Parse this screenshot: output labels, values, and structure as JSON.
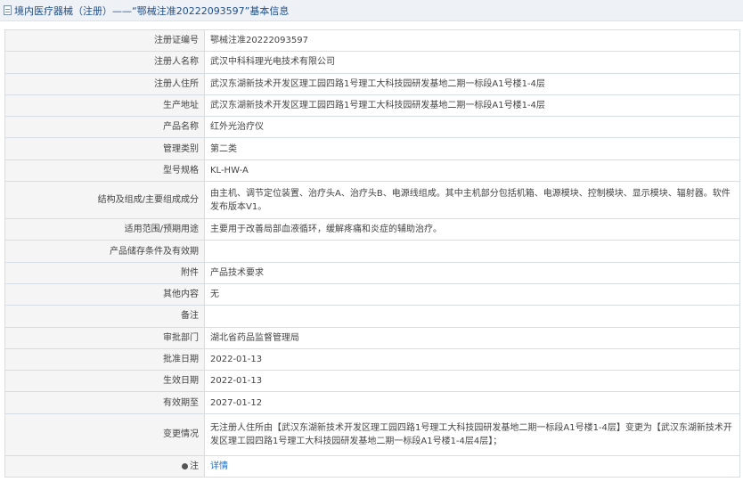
{
  "header": {
    "title": "境内医疗器械（注册）——“鄂械注准20222093597”基本信息"
  },
  "rows": [
    {
      "label": "注册证编号",
      "value": "鄂械注准20222093597"
    },
    {
      "label": "注册人名称",
      "value": "武汉中科科理光电技术有限公司"
    },
    {
      "label": "注册人住所",
      "value": "武汉东湖新技术开发区理工园四路1号理工大科技园研发基地二期一标段A1号楼1-4层"
    },
    {
      "label": "生产地址",
      "value": "武汉东湖新技术开发区理工园四路1号理工大科技园研发基地二期一标段A1号楼1-4层"
    },
    {
      "label": "产品名称",
      "value": "红外光治疗仪"
    },
    {
      "label": "管理类别",
      "value": "第二类"
    },
    {
      "label": "型号规格",
      "value": "KL-HW-A"
    },
    {
      "label": "结构及组成/主要组成成分",
      "value": "由主机、调节定位装置、治疗头A、治疗头B、电源线组成。其中主机部分包括机箱、电源模块、控制模块、显示模块、辐射器。软件发布版本V1。"
    },
    {
      "label": "适用范围/预期用途",
      "value": "主要用于改善局部血液循环，缓解疼痛和炎症的辅助治疗。"
    },
    {
      "label": "产品储存条件及有效期",
      "value": ""
    },
    {
      "label": "附件",
      "value": "产品技术要求"
    },
    {
      "label": "其他内容",
      "value": "无"
    },
    {
      "label": "备注",
      "value": ""
    },
    {
      "label": "审批部门",
      "value": "湖北省药品监督管理局"
    },
    {
      "label": "批准日期",
      "value": "2022-01-13"
    },
    {
      "label": "生效日期",
      "value": "2022-01-13"
    },
    {
      "label": "有效期至",
      "value": "2027-01-12"
    },
    {
      "label": "变更情况",
      "value": "无注册人住所由【武汉东湖新技术开发区理工园四路1号理工大科技园研发基地二期一标段A1号楼1-4层】变更为【武汉东湖新技术开发区理工园四路1号理工大科技园研发基地二期一标段A1号楼1-4层4层】；"
    },
    {
      "label": "注",
      "value": "详情"
    }
  ],
  "icons": {
    "header": "document-icon",
    "note": "bulb-icon"
  },
  "colors": {
    "header_bg": "#eef1f5",
    "title": "#1f4e8c",
    "label_bg": "#f5f5f5",
    "border": "#d7dde5",
    "link": "#1f6fc5"
  }
}
